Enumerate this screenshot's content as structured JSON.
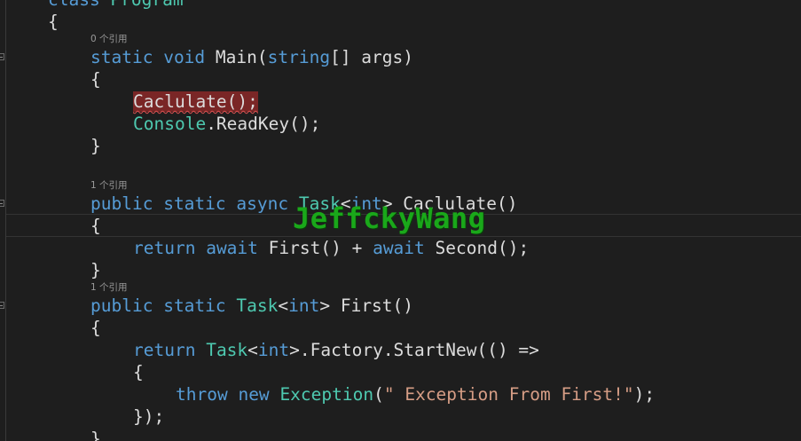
{
  "code": {
    "line_class": [
      "class",
      "Program"
    ],
    "open_brace": "{",
    "close_brace": "}",
    "lens_main": "0 个引用",
    "main_sig": [
      "static",
      "void",
      "Main(",
      "string",
      "[] args)"
    ],
    "main_call1": "Caclulate();",
    "main_call2": [
      "Console",
      ".ReadKey();"
    ],
    "lens_calc": "1 个引用",
    "calc_sig": [
      "public",
      "static",
      "async",
      "Task",
      "<",
      "int",
      "> Caclulate()"
    ],
    "calc_body": [
      "return",
      "await",
      "First() +",
      "await",
      "Second();"
    ],
    "lens_first": "1 个引用",
    "first_sig": [
      "public",
      "static",
      "Task",
      "<",
      "int",
      "> First()"
    ],
    "first_ret": [
      "return",
      "Task",
      "<",
      "int",
      ">.Factory.StartNew(() =>"
    ],
    "throw_line": [
      "throw",
      "new",
      "Exception",
      "(",
      "\" Exception From First!\"",
      ");"
    ],
    "lambda_end": "});"
  },
  "watermark": "JeffckyWang"
}
